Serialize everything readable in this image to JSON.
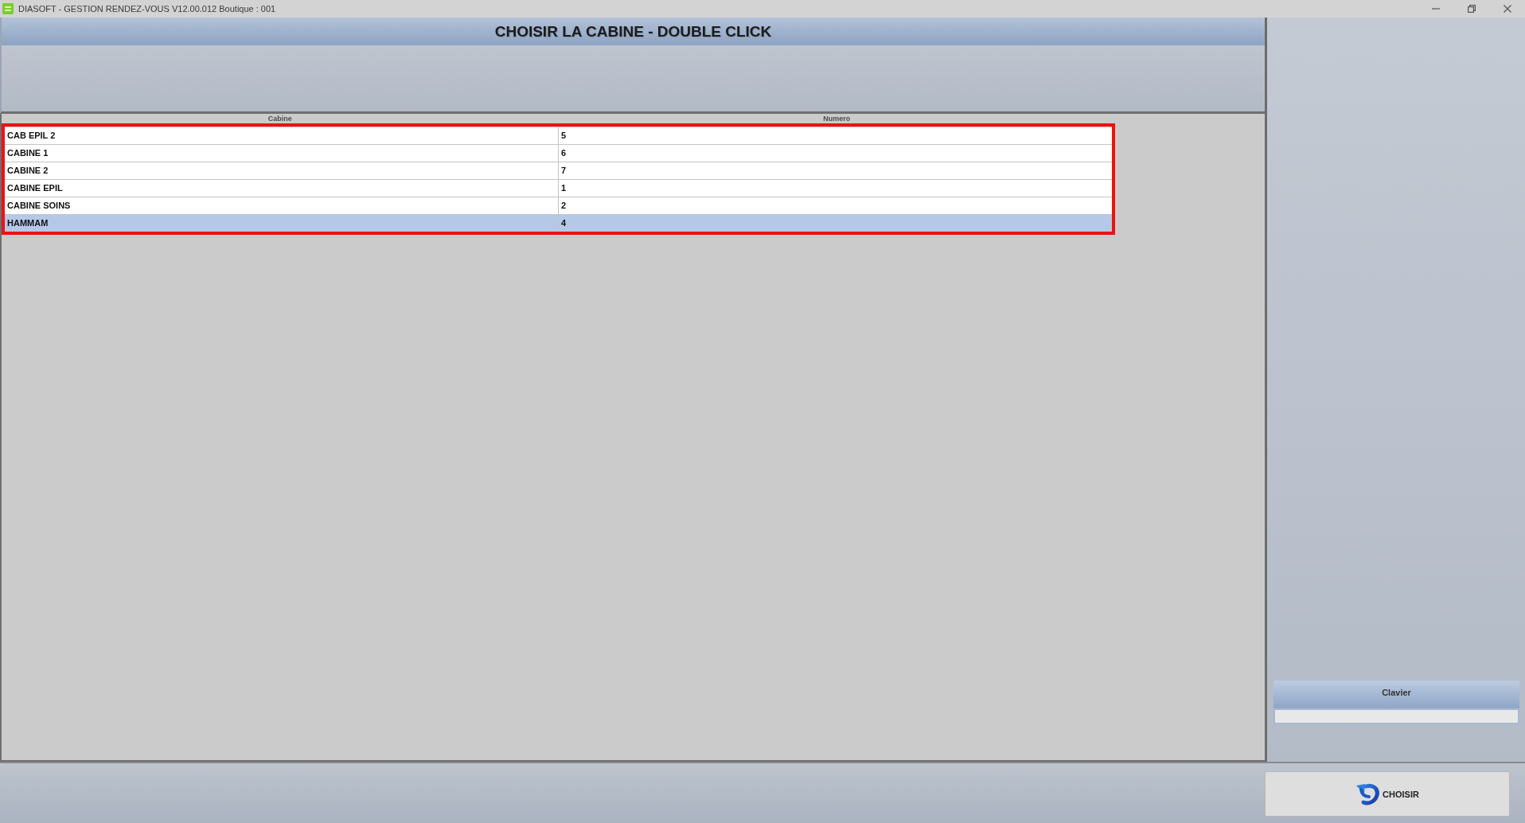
{
  "window": {
    "title": "DIASOFT - GESTION RENDEZ-VOUS V12.00.012 Boutique : 001"
  },
  "header": {
    "title": "CHOISIR LA CABINE - DOUBLE CLICK"
  },
  "table": {
    "columns": [
      "Cabine",
      "Numero"
    ],
    "rows": [
      {
        "cells": [
          "CAB EPIL 2",
          "5"
        ],
        "selected": false
      },
      {
        "cells": [
          "CABINE 1",
          "6"
        ],
        "selected": false
      },
      {
        "cells": [
          "CABINE 2",
          "7"
        ],
        "selected": false
      },
      {
        "cells": [
          "CABINE EPIL",
          "1"
        ],
        "selected": false
      },
      {
        "cells": [
          "CABINE SOINS",
          "2"
        ],
        "selected": false
      },
      {
        "cells": [
          "HAMMAM",
          "4"
        ],
        "selected": true
      }
    ]
  },
  "keyboard_panel": {
    "title": "Clavier"
  },
  "buttons": [
    {
      "label": "CHOISIR"
    }
  ]
}
